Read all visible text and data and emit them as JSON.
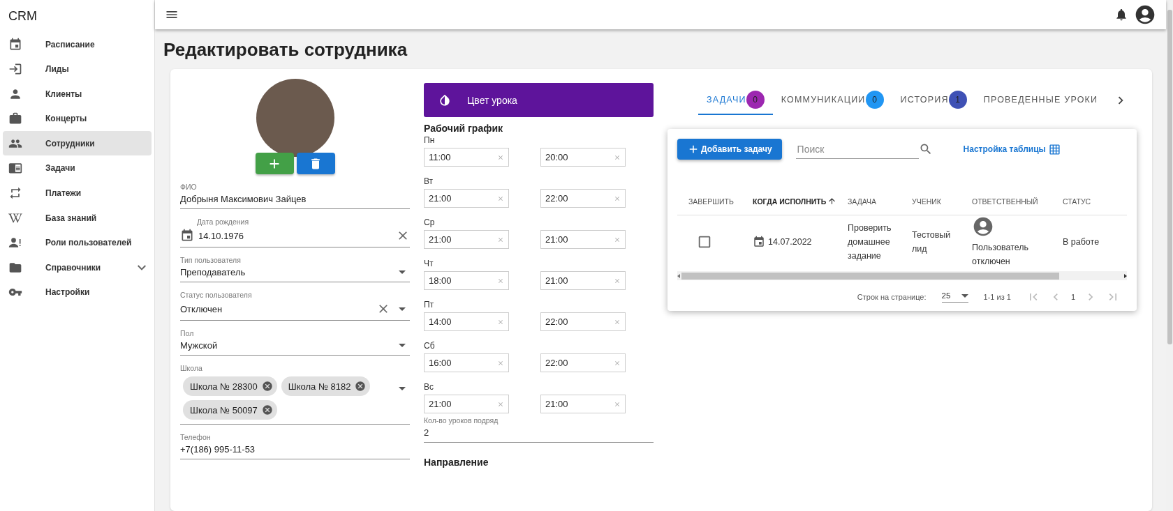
{
  "sidebar": {
    "logo": "CRM",
    "items": [
      {
        "label": "Расписание",
        "selected": false,
        "expandable": false
      },
      {
        "label": "Лиды",
        "selected": false,
        "expandable": false
      },
      {
        "label": "Клиенты",
        "selected": false,
        "expandable": false
      },
      {
        "label": "Концерты",
        "selected": false,
        "expandable": false
      },
      {
        "label": "Сотрудники",
        "selected": true,
        "expandable": false
      },
      {
        "label": "Задачи",
        "selected": false,
        "expandable": false
      },
      {
        "label": "Платежи",
        "selected": false,
        "expandable": false
      },
      {
        "label": "База знаний",
        "selected": false,
        "expandable": false
      },
      {
        "label": "Роли пользователей",
        "selected": false,
        "expandable": false
      },
      {
        "label": "Справочники",
        "selected": false,
        "expandable": true
      },
      {
        "label": "Настройки",
        "selected": false,
        "expandable": false
      }
    ]
  },
  "page_title": "Редактировать сотрудника",
  "profile": {
    "fields": [
      {
        "kind": "text",
        "label": "ФИО",
        "value": "Добрыня Максимович Зайцев",
        "clearable": false
      },
      {
        "kind": "date",
        "label": "Дата рождения",
        "value": "14.10.1976",
        "clearable": true
      },
      {
        "kind": "select",
        "label": "Тип пользователя",
        "value": "Преподаватель",
        "clearable": false
      },
      {
        "kind": "select",
        "label": "Статус пользователя",
        "value": "Отключен",
        "clearable": true
      },
      {
        "kind": "select",
        "label": "Пол",
        "value": "Мужской",
        "clearable": false
      },
      {
        "kind": "chips",
        "label": "Школа",
        "chips": [
          "Школа № 28300",
          "Школа № 8182",
          "Школа № 50097"
        ],
        "clearable": false
      },
      {
        "kind": "text",
        "label": "Телефон",
        "value": "+7(186) 995-11-53",
        "clearable": false
      }
    ]
  },
  "schedule": {
    "lesson_color": {
      "label": "Цвет урока",
      "color": "#5e149b"
    },
    "title": "Рабочий график",
    "days": [
      {
        "day": "Пн",
        "from": "11:00",
        "to": "20:00"
      },
      {
        "day": "Вт",
        "from": "21:00",
        "to": "22:00"
      },
      {
        "day": "Ср",
        "from": "21:00",
        "to": "21:00"
      },
      {
        "day": "Чт",
        "from": "18:00",
        "to": "21:00"
      },
      {
        "day": "Пт",
        "from": "14:00",
        "to": "22:00"
      },
      {
        "day": "Сб",
        "from": "16:00",
        "to": "22:00"
      },
      {
        "day": "Вс",
        "from": "21:00",
        "to": "21:00"
      }
    ],
    "lessons_in_row": {
      "label": "Кол-во уроков подряд",
      "value": "2"
    },
    "direction_title": "Направление"
  },
  "tabs": [
    {
      "label": "ЗАДАЧИ",
      "badge": "0",
      "color": "#9c27b0",
      "selected": true
    },
    {
      "label": "КОММУНИКАЦИИ",
      "badge": "0",
      "color": "#2196f3",
      "selected": false
    },
    {
      "label": "ИСТОРИЯ",
      "badge": "1",
      "color": "#3f51b5",
      "selected": false
    },
    {
      "label": "ПРОВЕДЕННЫЕ УРОКИ",
      "selected": false
    }
  ],
  "tasks": {
    "add_button": "Добавить задачу",
    "search": {
      "placeholder": "Поиск"
    },
    "table_settings": "Настройка таблицы",
    "columns": [
      {
        "label": "ЗАВЕРШИТЬ",
        "sorted": false
      },
      {
        "label": "КОГДА ИСПОЛНИТЬ",
        "sorted": true
      },
      {
        "label": "ЗАДАЧА",
        "sorted": false
      },
      {
        "label": "УЧЕНИК",
        "sorted": false
      },
      {
        "label": "ОТВЕТСТВЕННЫЙ",
        "sorted": false
      },
      {
        "label": "СТАТУС",
        "sorted": false
      }
    ],
    "rows": [
      {
        "checked": false,
        "due": "14.07.2022",
        "task": "Проверить домашнее задание",
        "student": "Тестовый лид",
        "responsible": "Пользователь отключен",
        "status": "В работе"
      }
    ],
    "pagination": {
      "rows_label": "Строк на странице:",
      "rows_per_page": "25",
      "range": "1-1 из 1",
      "page": "1"
    }
  }
}
